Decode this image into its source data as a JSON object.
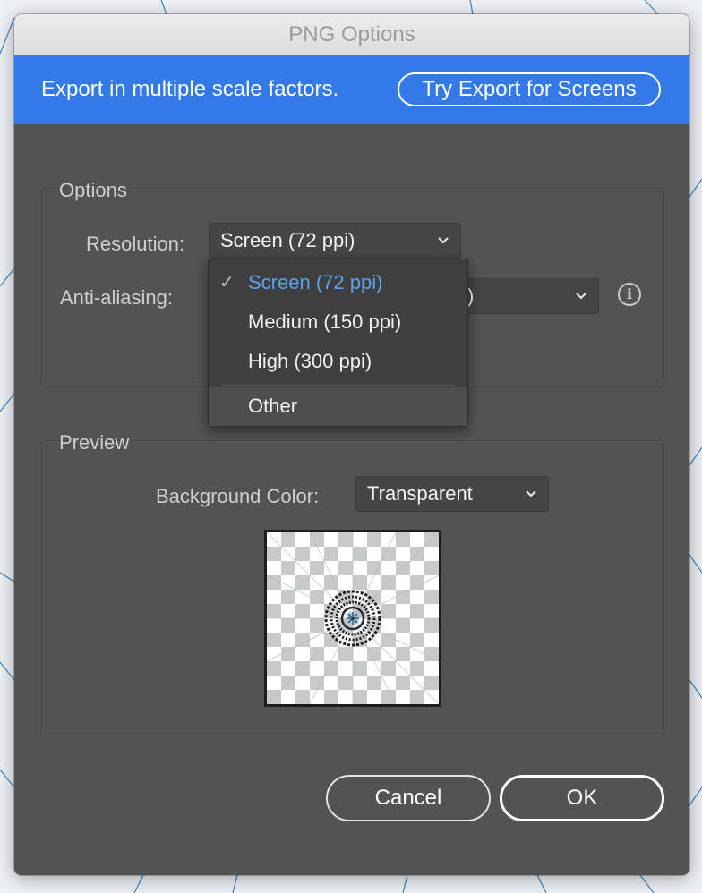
{
  "window": {
    "title": "PNG Options"
  },
  "banner": {
    "text": "Export in multiple scale factors.",
    "button_label": "Try Export for Screens",
    "color": "#3479e8"
  },
  "options": {
    "group_title": "Options",
    "resolution": {
      "label": "Resolution:",
      "value": "Screen (72 ppi)"
    },
    "anti_aliasing": {
      "label": "Anti-aliasing:",
      "value_visible_fragment": ")"
    }
  },
  "resolution_menu": {
    "items": [
      {
        "label": "Screen (72 ppi)",
        "checked": true
      },
      {
        "label": "Medium (150 ppi)",
        "checked": false
      },
      {
        "label": "High (300 ppi)",
        "checked": false
      },
      {
        "label": "Other",
        "checked": false,
        "hovered": true
      }
    ],
    "check_glyph": "✓",
    "selected_color": "#5ba0e8"
  },
  "preview": {
    "group_title": "Preview",
    "background_color": {
      "label": "Background Color:",
      "value": "Transparent"
    }
  },
  "buttons": {
    "cancel": "Cancel",
    "ok": "OK"
  },
  "icons": {
    "chevron": "chevron-down-icon",
    "info": "info-icon",
    "info_glyph": "i"
  }
}
